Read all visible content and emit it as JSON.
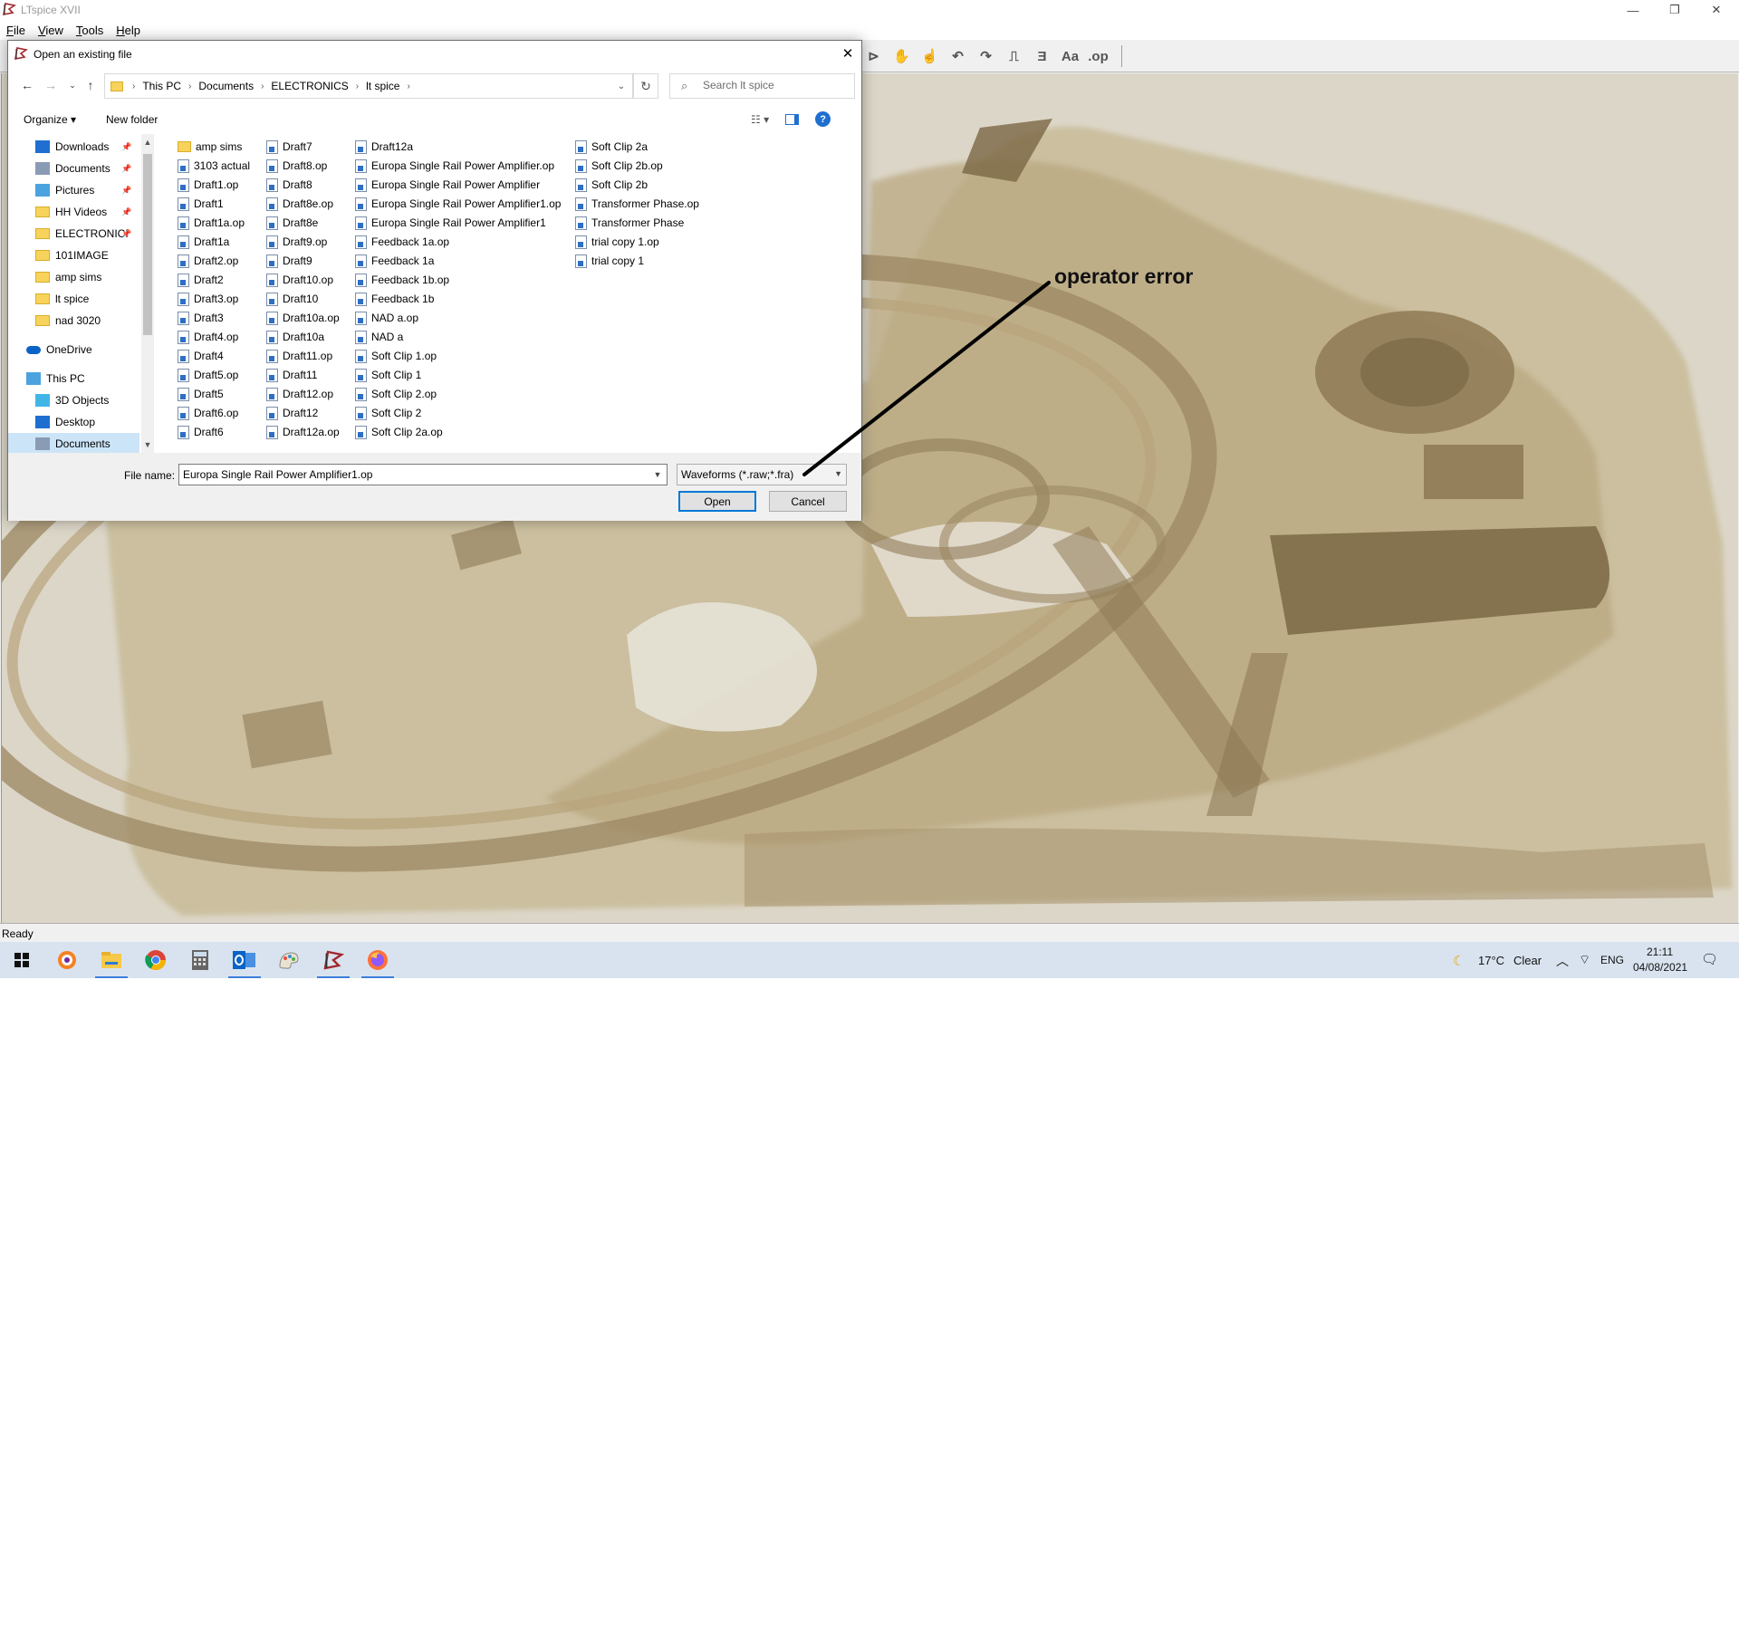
{
  "app": {
    "title": "LTspice XVII",
    "menu": [
      "File",
      "View",
      "Tools",
      "Help"
    ],
    "window_controls": [
      "minimize-icon",
      "restore-icon",
      "close-icon"
    ],
    "toolbar_icons": [
      "component-icon",
      "move-icon",
      "drag-icon",
      "undo-icon",
      "redo-icon",
      "rotate-icon",
      "mirror-icon",
      "text-icon",
      "spice-directive-icon"
    ],
    "toolbar_glyphs": [
      "⊳",
      "✋",
      "☝",
      "↶",
      "↷",
      "⎍",
      "Ǝ",
      "Aa",
      ".op"
    ],
    "status": "Ready"
  },
  "dialog": {
    "title": "Open an existing file",
    "breadcrumb": [
      "This PC",
      "Documents",
      "ELECTRONICS",
      "lt spice"
    ],
    "search_placeholder": "Search lt spice",
    "organize_label": "Organize ▾",
    "new_folder_label": "New folder",
    "nav_items": [
      {
        "label": "Downloads",
        "icon": "downloads-icon",
        "pinned": true
      },
      {
        "label": "Documents",
        "icon": "documents-icon",
        "pinned": true
      },
      {
        "label": "Pictures",
        "icon": "pictures-icon",
        "pinned": true
      },
      {
        "label": "HH Videos",
        "icon": "folder-icon",
        "pinned": true
      },
      {
        "label": "ELECTRONIC!",
        "icon": "folder-icon",
        "pinned": true
      },
      {
        "label": "101IMAGE",
        "icon": "folder-icon",
        "pinned": false
      },
      {
        "label": "amp sims",
        "icon": "folder-icon",
        "pinned": false
      },
      {
        "label": "lt spice",
        "icon": "folder-icon",
        "pinned": false
      },
      {
        "label": "nad 3020",
        "icon": "folder-icon",
        "pinned": false
      },
      {
        "label": "OneDrive",
        "icon": "onedrive-icon",
        "pinned": false
      },
      {
        "label": "This PC",
        "icon": "this-pc-icon",
        "pinned": false
      },
      {
        "label": "3D Objects",
        "icon": "3d-objects-icon",
        "pinned": false
      },
      {
        "label": "Desktop",
        "icon": "desktop-icon",
        "pinned": false
      },
      {
        "label": "Documents",
        "icon": "documents-icon",
        "pinned": false,
        "selected": true
      }
    ],
    "files": [
      [
        {
          "name": "amp sims",
          "type": "folder"
        },
        {
          "name": "3103 actual",
          "type": "doc"
        },
        {
          "name": "Draft1.op",
          "type": "doc"
        },
        {
          "name": "Draft1",
          "type": "doc"
        },
        {
          "name": "Draft1a.op",
          "type": "doc"
        },
        {
          "name": "Draft1a",
          "type": "doc"
        },
        {
          "name": "Draft2.op",
          "type": "doc"
        },
        {
          "name": "Draft2",
          "type": "doc"
        },
        {
          "name": "Draft3.op",
          "type": "doc"
        },
        {
          "name": "Draft3",
          "type": "doc"
        },
        {
          "name": "Draft4.op",
          "type": "doc"
        },
        {
          "name": "Draft4",
          "type": "doc"
        },
        {
          "name": "Draft5.op",
          "type": "doc"
        },
        {
          "name": "Draft5",
          "type": "doc"
        },
        {
          "name": "Draft6.op",
          "type": "doc"
        },
        {
          "name": "Draft6",
          "type": "doc"
        }
      ],
      [
        {
          "name": "Draft7",
          "type": "doc"
        },
        {
          "name": "Draft8.op",
          "type": "doc"
        },
        {
          "name": "Draft8",
          "type": "doc"
        },
        {
          "name": "Draft8e.op",
          "type": "doc"
        },
        {
          "name": "Draft8e",
          "type": "doc"
        },
        {
          "name": "Draft9.op",
          "type": "doc"
        },
        {
          "name": "Draft9",
          "type": "doc"
        },
        {
          "name": "Draft10.op",
          "type": "doc"
        },
        {
          "name": "Draft10",
          "type": "doc"
        },
        {
          "name": "Draft10a.op",
          "type": "doc"
        },
        {
          "name": "Draft10a",
          "type": "doc"
        },
        {
          "name": "Draft11.op",
          "type": "doc"
        },
        {
          "name": "Draft11",
          "type": "doc"
        },
        {
          "name": "Draft12.op",
          "type": "doc"
        },
        {
          "name": "Draft12",
          "type": "doc"
        },
        {
          "name": "Draft12a.op",
          "type": "doc"
        }
      ],
      [
        {
          "name": "Draft12a",
          "type": "doc"
        },
        {
          "name": "Europa Single Rail Power Amplifier.op",
          "type": "doc"
        },
        {
          "name": "Europa Single Rail Power Amplifier",
          "type": "doc"
        },
        {
          "name": "Europa Single Rail Power Amplifier1.op",
          "type": "doc"
        },
        {
          "name": "Europa Single Rail Power Amplifier1",
          "type": "doc"
        },
        {
          "name": "Feedback 1a.op",
          "type": "doc"
        },
        {
          "name": "Feedback 1a",
          "type": "doc"
        },
        {
          "name": "Feedback 1b.op",
          "type": "doc"
        },
        {
          "name": "Feedback 1b",
          "type": "doc"
        },
        {
          "name": "NAD a.op",
          "type": "doc"
        },
        {
          "name": "NAD a",
          "type": "doc"
        },
        {
          "name": "Soft Clip 1.op",
          "type": "doc"
        },
        {
          "name": "Soft Clip 1",
          "type": "doc"
        },
        {
          "name": "Soft Clip 2.op",
          "type": "doc"
        },
        {
          "name": "Soft Clip 2",
          "type": "doc"
        },
        {
          "name": "Soft Clip 2a.op",
          "type": "doc"
        }
      ],
      [
        {
          "name": "Soft Clip 2a",
          "type": "doc"
        },
        {
          "name": "Soft Clip 2b.op",
          "type": "doc"
        },
        {
          "name": "Soft Clip 2b",
          "type": "doc"
        },
        {
          "name": "Transformer Phase.op",
          "type": "doc"
        },
        {
          "name": "Transformer Phase",
          "type": "doc"
        },
        {
          "name": "trial copy 1.op",
          "type": "doc"
        },
        {
          "name": "trial copy 1",
          "type": "doc"
        }
      ]
    ],
    "file_name_label": "File name:",
    "file_name_value": "Europa Single Rail Power Amplifier1.op",
    "file_type_value": "Waveforms (*.raw;*.fra)",
    "open_label": "Open",
    "cancel_label": "Cancel"
  },
  "annotation": {
    "text": "operator error"
  },
  "taskbar": {
    "apps": [
      "windows-start-icon",
      "avast-icon",
      "file-explorer-icon",
      "chrome-icon",
      "calculator-icon",
      "outlook-icon",
      "paint-icon",
      "ltspice-icon",
      "firefox-icon"
    ],
    "weather_temp": "17°C",
    "weather_desc": "Clear",
    "language": "ENG",
    "time": "21:11",
    "date": "04/08/2021"
  },
  "colors": {
    "accent": "#0078d7",
    "selection": "#cce4f7",
    "canvas_bg": "#dcd6c8",
    "sepia": "#8a7658"
  }
}
